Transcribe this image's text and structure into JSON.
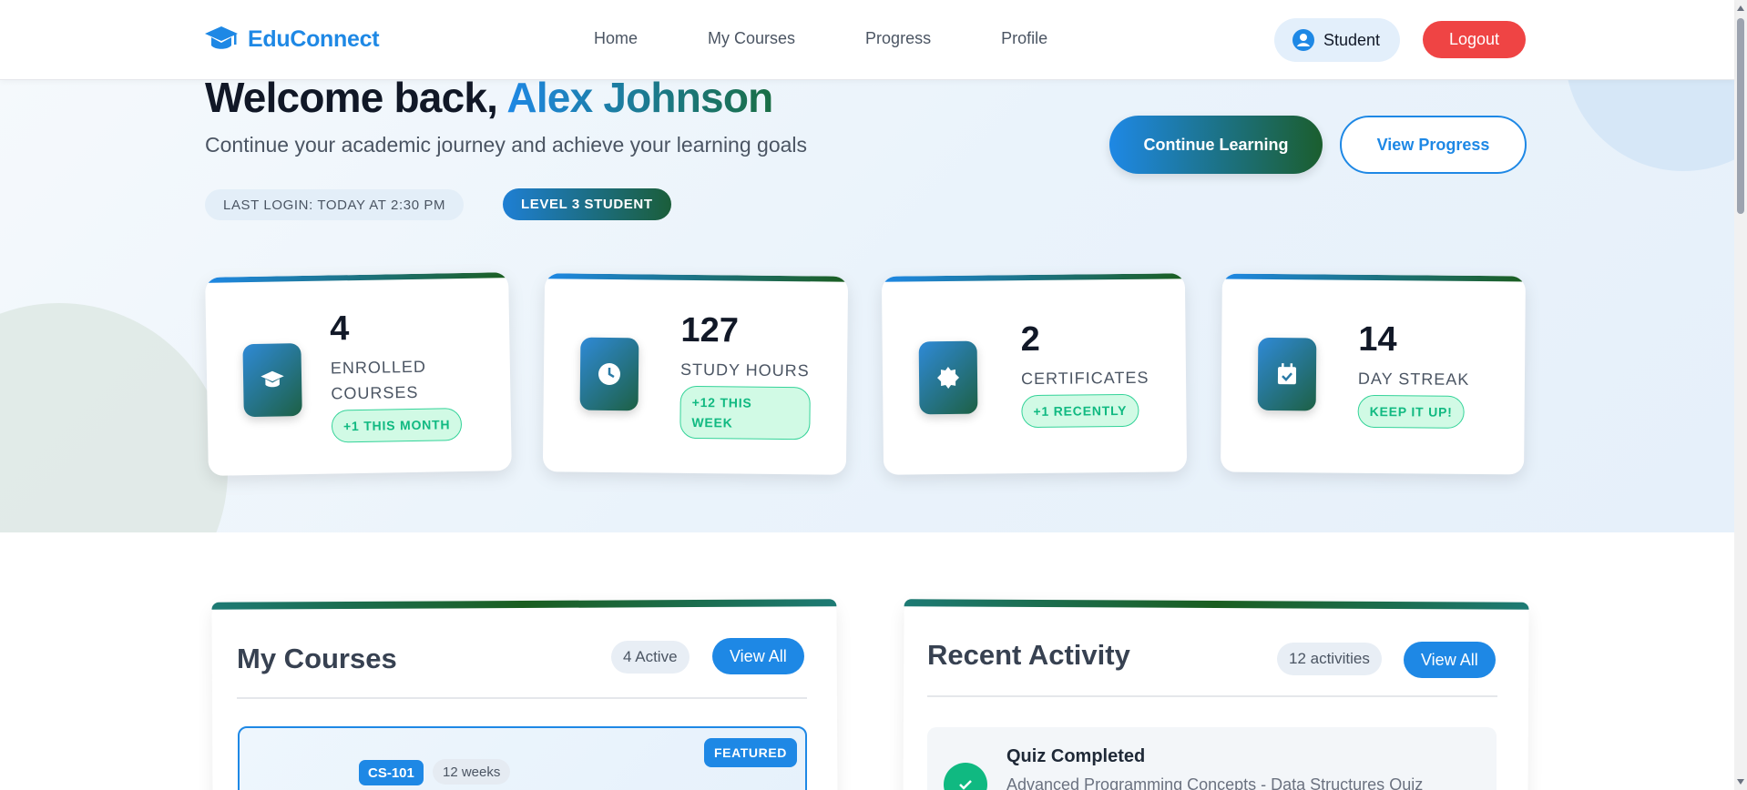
{
  "header": {
    "brand": "EduConnect",
    "nav": [
      "Home",
      "My Courses",
      "Progress",
      "Profile"
    ],
    "user_label": "Student",
    "logout_label": "Logout"
  },
  "hero": {
    "welcome_prefix": "Welcome back,",
    "user_name": "Alex Johnson",
    "subtitle": "Continue your academic journey and achieve your learning goals",
    "last_login": "LAST LOGIN: TODAY AT 2:30 PM",
    "level": "LEVEL 3 STUDENT",
    "continue_label": "Continue Learning",
    "view_progress_label": "View Progress"
  },
  "stats": [
    {
      "value": "4",
      "label_line1": "ENROLLED",
      "label_line2": "COURSES",
      "chip": "+1 THIS MONTH",
      "icon": "graduation-cap-icon"
    },
    {
      "value": "127",
      "label_line1": "STUDY HOURS",
      "label_line2": "",
      "chip_line1": "+12 THIS",
      "chip_line2": "WEEK",
      "icon": "clock-icon"
    },
    {
      "value": "2",
      "label_line1": "CERTIFICATES",
      "label_line2": "",
      "chip": "+1 RECENTLY",
      "icon": "certificate-icon"
    },
    {
      "value": "14",
      "label_line1": "DAY STREAK",
      "label_line2": "",
      "chip": "KEEP IT UP!",
      "icon": "calendar-check-icon"
    }
  ],
  "courses": {
    "title": "My Courses",
    "count": "4 Active",
    "view_all": "View All",
    "featured_course": {
      "code": "CS-101",
      "duration": "12 weeks",
      "badge": "FEATURED"
    }
  },
  "activity": {
    "title": "Recent Activity",
    "count": "12 activities",
    "view_all": "View All",
    "items": [
      {
        "title": "Quiz Completed",
        "description": "Advanced Programming Concepts - Data Structures Quiz"
      }
    ]
  },
  "colors": {
    "primary": "#1e88e5",
    "accent_green": "#1b5e20",
    "danger": "#ef4444",
    "success": "#10b981"
  }
}
